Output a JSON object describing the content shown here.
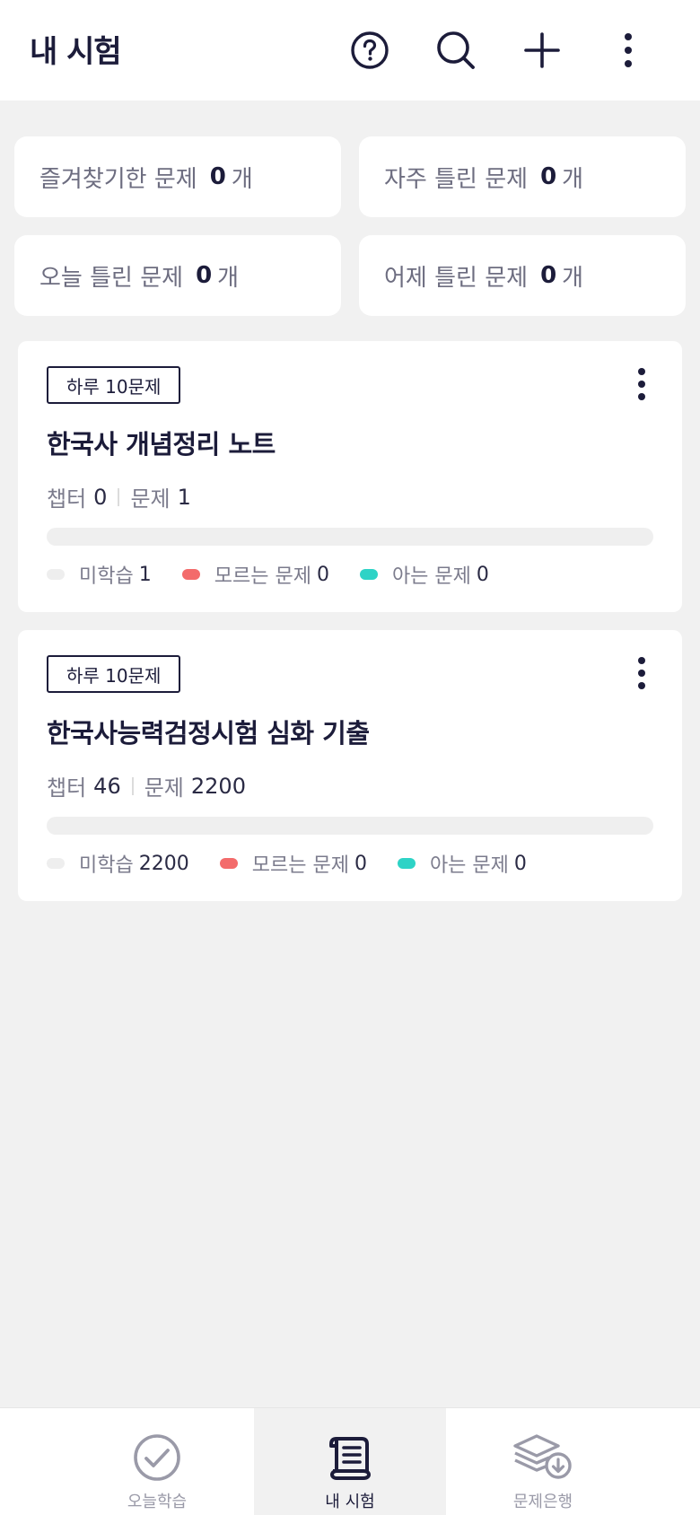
{
  "header": {
    "title": "내 시험"
  },
  "stats": [
    {
      "label": "즐겨찾기한 문제",
      "count": "0",
      "unit": "개"
    },
    {
      "label": "자주 틀린 문제",
      "count": "0",
      "unit": "개"
    },
    {
      "label": "오늘 틀린 문제",
      "count": "0",
      "unit": "개"
    },
    {
      "label": "어제 틀린 문제",
      "count": "0",
      "unit": "개"
    }
  ],
  "exams": [
    {
      "badge": "하루 10문제",
      "title": "한국사 개념정리 노트",
      "chapter_label": "챕터",
      "chapter_value": "0",
      "question_label": "문제",
      "question_value": "1",
      "legend": [
        {
          "label": "미학습",
          "count": "1",
          "color": "#eeeeee"
        },
        {
          "label": "모르는 문제",
          "count": "0",
          "color": "#f36b6b"
        },
        {
          "label": "아는 문제",
          "count": "0",
          "color": "#2ed3c6"
        }
      ]
    },
    {
      "badge": "하루 10문제",
      "title": "한국사능력검정시험 심화 기출",
      "chapter_label": "챕터",
      "chapter_value": "46",
      "question_label": "문제",
      "question_value": "2200",
      "legend": [
        {
          "label": "미학습",
          "count": "2200",
          "color": "#eeeeee"
        },
        {
          "label": "모르는 문제",
          "count": "0",
          "color": "#f36b6b"
        },
        {
          "label": "아는 문제",
          "count": "0",
          "color": "#2ed3c6"
        }
      ]
    }
  ],
  "nav": [
    {
      "label": "오늘학습",
      "icon": "check-circle-icon",
      "active": false
    },
    {
      "label": "내 시험",
      "icon": "scroll-icon",
      "active": true
    },
    {
      "label": "문제은행",
      "icon": "layers-download-icon",
      "active": false
    }
  ],
  "colors": {
    "primary": "#1c1c3a",
    "wrong": "#f36b6b",
    "known": "#2ed3c6",
    "background": "#f1f1f1"
  }
}
